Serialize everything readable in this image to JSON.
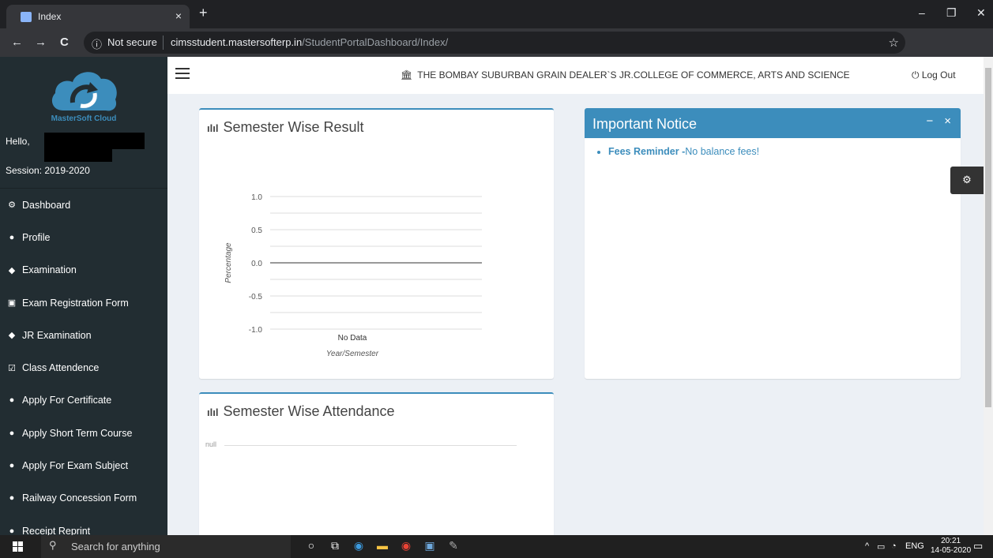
{
  "browser": {
    "tab_title": "Index",
    "tab_close": "×",
    "new_tab": "+",
    "not_secure": "Not secure",
    "url_host": "cimsstudent.mastersofterp.in",
    "url_path": "/StudentPortalDashboard/Index/",
    "controls": {
      "minimize": "–",
      "maximize": "❐",
      "close": "✕"
    }
  },
  "sidebar": {
    "logo_text": "MasterSoft Cloud",
    "hello": "Hello,",
    "session": "Session: 2019-2020",
    "items": [
      {
        "label": "Dashboard",
        "icon": "⚙"
      },
      {
        "label": "Profile",
        "icon": "●"
      },
      {
        "label": "Examination",
        "icon": "◆"
      },
      {
        "label": "Exam Registration Form",
        "icon": "▣"
      },
      {
        "label": "JR Examination",
        "icon": "◆"
      },
      {
        "label": "Class Attendence",
        "icon": "☑"
      },
      {
        "label": "Apply For Certificate",
        "icon": "●"
      },
      {
        "label": "Apply Short Term Course",
        "icon": "●"
      },
      {
        "label": "Apply For Exam Subject",
        "icon": "●"
      },
      {
        "label": "Railway Concession Form",
        "icon": "●"
      },
      {
        "label": "Receipt Reprint",
        "icon": "●"
      }
    ]
  },
  "header": {
    "college": "THE BOMBAY SUBURBAN GRAIN DEALER`S JR.COLLEGE OF COMMERCE, ARTS AND SCIENCE",
    "logout": "Log Out"
  },
  "result_box": {
    "title": "Semester Wise Result"
  },
  "attendance_box": {
    "title": "Semester Wise Attendance",
    "null_label": "null"
  },
  "notice": {
    "title": "Important Notice",
    "items": [
      {
        "bold": "Fees Reminder -",
        "text": "No balance fees!"
      }
    ]
  },
  "taskbar": {
    "search": "Search for anything",
    "lang": "ENG",
    "time": "20:21",
    "date": "14-05-2020"
  },
  "chart_data": {
    "type": "line",
    "ylabel": "Percentage",
    "xlabel": "Year/Semester",
    "yticks": [
      "1.0",
      "0.5",
      "0.0",
      "-0.5",
      "-1.0"
    ],
    "ylim": [
      -1.0,
      1.0
    ],
    "x_note": "No Data",
    "series": [],
    "grid": true
  },
  "colors": {
    "accent": "#3c8dbc",
    "sidebar": "#222d32",
    "bg": "#ecf0f5"
  }
}
